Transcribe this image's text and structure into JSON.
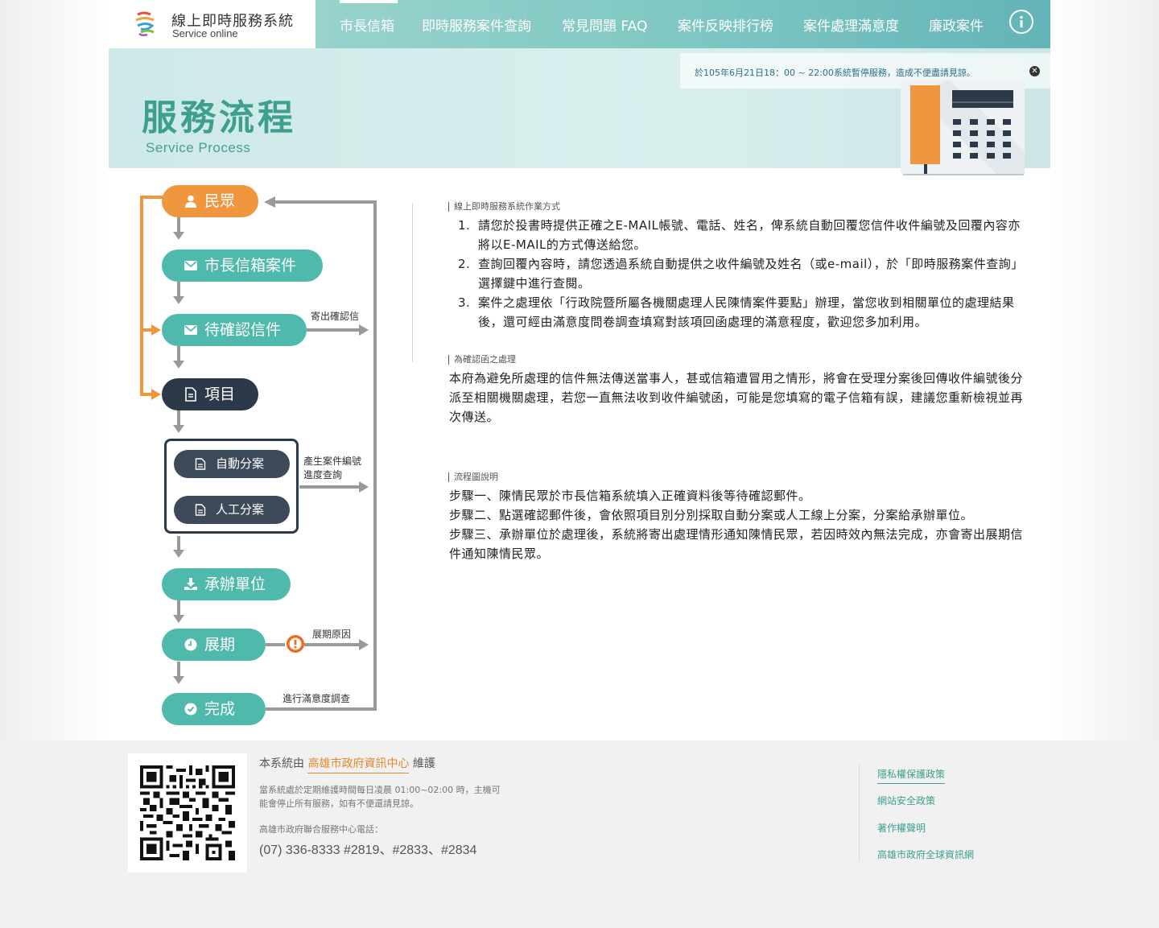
{
  "header": {
    "logo_title": "線上即時服務系統",
    "logo_subtitle": "Service online",
    "nav": [
      {
        "label": "市長信箱"
      },
      {
        "label": "即時服務案件查詢"
      },
      {
        "label": "常見問題 FAQ"
      },
      {
        "label": "案件反映排行榜"
      },
      {
        "label": "案件處理滿意度"
      },
      {
        "label": "廉政案件"
      }
    ],
    "info_icon": "info-circle-icon"
  },
  "hero": {
    "title": "服務流程",
    "subtitle": "Service Process",
    "notice": "於105年6月21日18：00 ~ 22:00系統暫停服務，造成不便盡請見諒。"
  },
  "flow": {
    "steps": {
      "citizen": "民眾",
      "mayor_mail": "市長信箱案件",
      "pending": "待確認信件",
      "item": "項目",
      "auto": "自動分案",
      "manual": "人工分案",
      "unit": "承辦單位",
      "extend": "展期",
      "done": "完成"
    },
    "notes": {
      "send_confirm": "寄出確認信",
      "case_number_1": "產生案件編號",
      "case_number_2": "進度查詢",
      "extend_reason": "展期原因",
      "survey": "進行滿意度調查"
    },
    "colors": {
      "orange": "#f0963f",
      "teal": "#4fb9ab",
      "dark": "#2c3948",
      "arrow": "#999999",
      "alert": "#f06a1c"
    }
  },
  "content": {
    "sec1_head": "線上即時服務系統作業方式",
    "sec1_items": [
      {
        "num": "1.",
        "text": "請您於投書時提供正確之E-MAIL帳號、電話、姓名，俾系統自動回覆您信件收件編號及回覆內容亦將以E-MAIL的方式傳送給您。"
      },
      {
        "num": "2.",
        "text": "查詢回覆內容時，請您透過系統自動提供之收件編號及姓名（或e-mail），於「即時服務案件查詢」選擇鍵中進行查閱。"
      },
      {
        "num": "3.",
        "text": "案件之處理依「行政院暨所屬各機關處理人民陳情案件要點」辦理，當您收到相關單位的處理結果後，還可經由滿意度問卷調查填寫對該項回函處理的滿意程度，歡迎您多加利用。"
      }
    ],
    "sec2_head": "為確認函之處理",
    "sec2_text": "本府為避免所處理的信件無法傳送當事人，甚或信箱遭冒用之情形，將會在受理分案後回傳收件編號後分派至相關機關處理，若您一直無法收到收件編號函，可能是您填寫的電子信箱有誤，建議您重新檢視並再次傳送。",
    "sec3_head": "流程圖說明",
    "sec3_lines": [
      "步驟一、陳情民眾於市長信箱系統填入正確資料後等待確認郵件。",
      "步驟二、點選確認郵件後，會依照項目別分別採取自動分案或人工線上分案，分案給承辦單位。",
      "步驟三、承辦單位於處理後，系統將寄出處理情形通知陳情民眾，若因時效內無法完成，亦會寄出展期信件通知陳情民眾。"
    ]
  },
  "footer": {
    "maint_prefix": "本系統由",
    "maint_link": "高雄市政府資訊中心",
    "maint_suffix": "維護",
    "note": "當系統處於定期維護時間每日凌晨 01:00~02:00 時，主機可能會停止所有服務，如有不便還請見諒。",
    "tel_label": "高雄市政府聯合服務中心電話：",
    "tel": "(07) 336-8333 #2819、#2833、#2834",
    "links": [
      {
        "label": "隱私權保護政策"
      },
      {
        "label": "網站安全政策"
      },
      {
        "label": "著作權聲明"
      },
      {
        "label": "高雄市政府全球資訊網"
      }
    ]
  }
}
